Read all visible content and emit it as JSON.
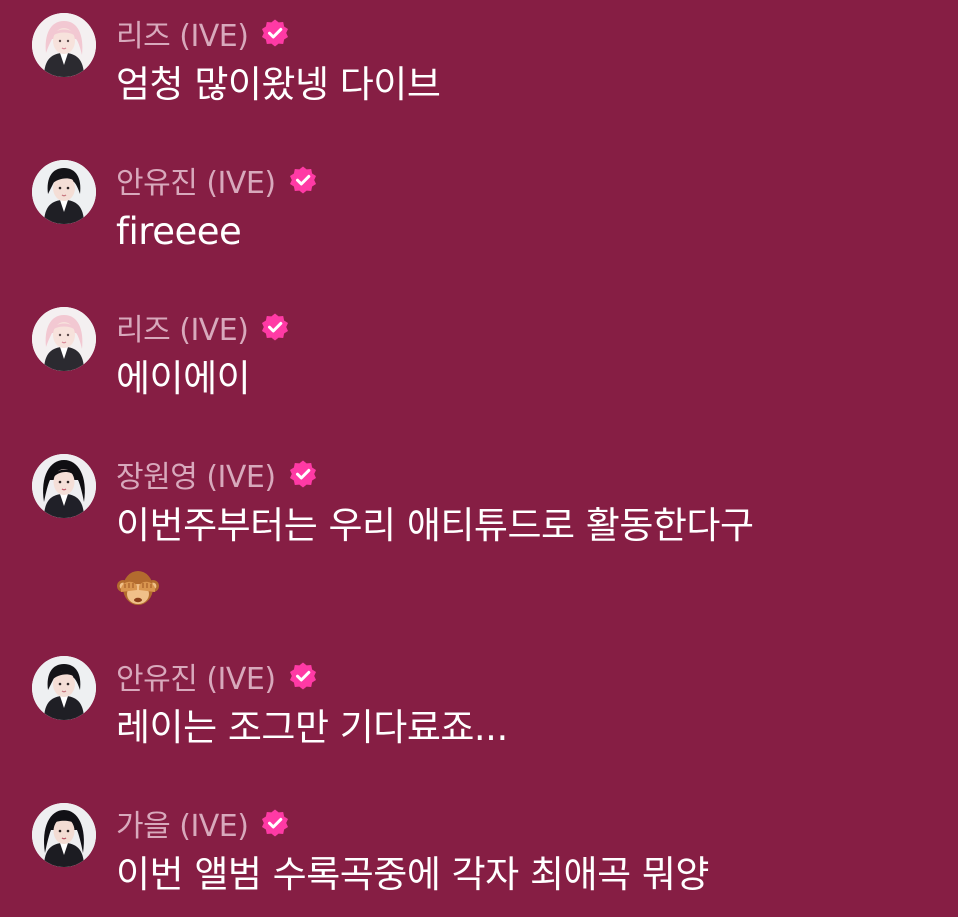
{
  "colors": {
    "background": "#861E44",
    "name_text": "#D8A9BC",
    "message_text": "#FFFFFF",
    "verified_badge": "#FF3AA5"
  },
  "messages": [
    {
      "name": "리즈 (IVE)",
      "text": "엄청 많이왔넹 다이브",
      "avatar_icon": "avatar-liz",
      "verified": true
    },
    {
      "name": "안유진 (IVE)",
      "text": "fireeee",
      "avatar_icon": "avatar-yujin",
      "verified": true
    },
    {
      "name": "리즈 (IVE)",
      "text": "에이에이",
      "avatar_icon": "avatar-liz",
      "verified": true
    },
    {
      "name": "장원영 (IVE)",
      "text": "이번주부터는 우리 애티튜드로 활동한다구",
      "emoji": "see-no-evil-monkey-icon",
      "avatar_icon": "avatar-wonyoung",
      "verified": true
    },
    {
      "name": "안유진 (IVE)",
      "text": "레이는 조그만 기다료죠...",
      "avatar_icon": "avatar-yujin",
      "verified": true
    },
    {
      "name": "가을 (IVE)",
      "text": "이번 앨범 수록곡중에 각자 최애곡 뭐양",
      "avatar_icon": "avatar-gaeul",
      "verified": true
    }
  ]
}
